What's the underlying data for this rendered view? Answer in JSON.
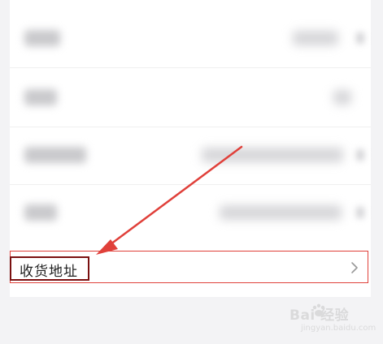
{
  "address_row": {
    "label": "收货地址",
    "chevron_icon": "chevron-right-icon"
  },
  "watermark": {
    "brand": "Bai 经验",
    "url": "jingyan.baidu.com",
    "icon": "paw-icon"
  },
  "colors": {
    "annotation_red": "#e0403a",
    "label_box": "#7a1010",
    "background": "#f3f3f5"
  }
}
